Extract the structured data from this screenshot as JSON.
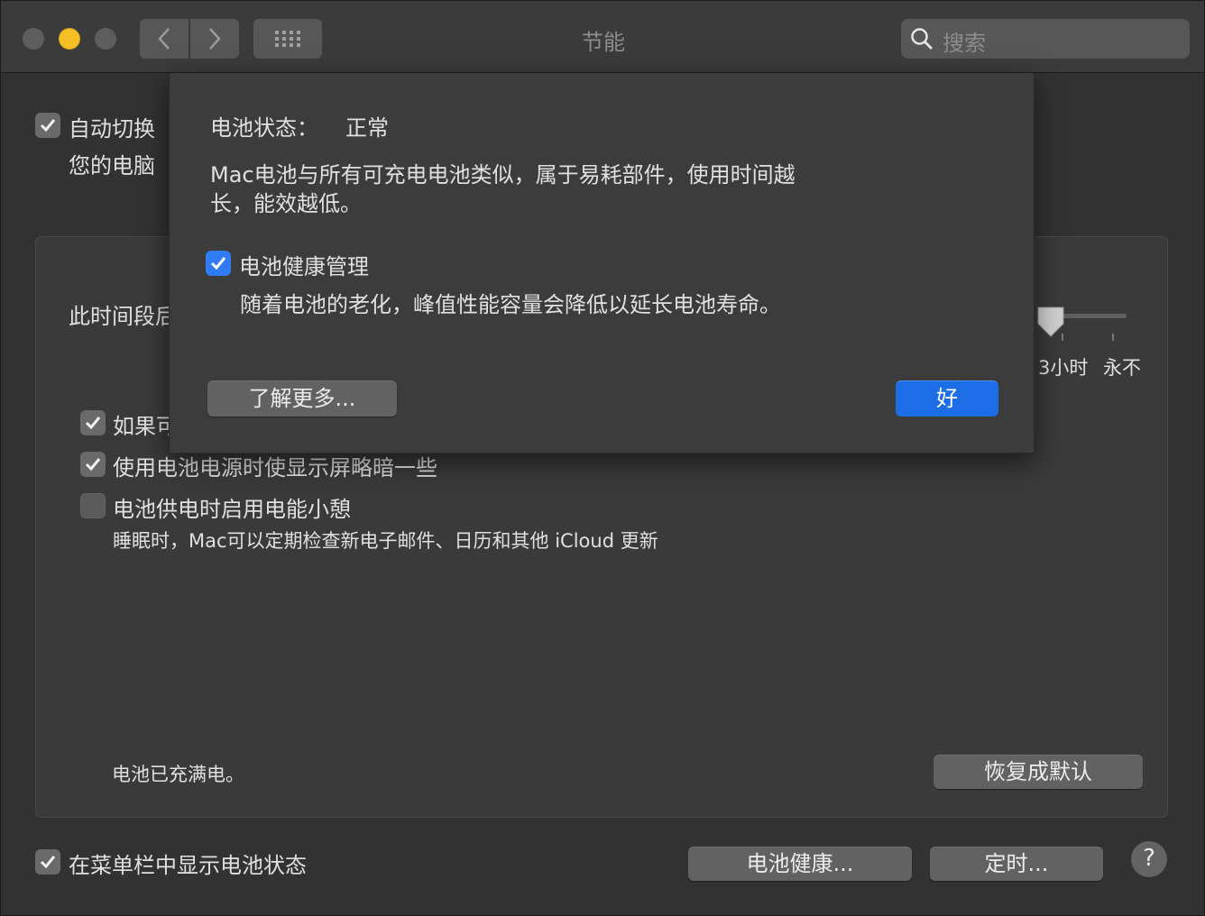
{
  "window": {
    "title": "节能",
    "search_placeholder": "搜索"
  },
  "top": {
    "auto_switch_label": "自动切换",
    "auto_switch_sub": "您的电脑"
  },
  "panel": {
    "turn_off_label": "此时间段后",
    "slider_labels": [
      "3小时",
      "永不"
    ],
    "options": [
      {
        "label": "如果可",
        "checked": true
      },
      {
        "label": "使用电池电源时使显示屏略暗一些",
        "checked": true
      },
      {
        "label": "电池供电时启用电能小憩",
        "checked": false,
        "description": "睡眠时，Mac可以定期检查新电子邮件、日历和其他 iCloud 更新"
      }
    ],
    "battery_status_text": "电池已充满电。",
    "restore_defaults_label": "恢复成默认"
  },
  "footer": {
    "show_in_menubar_label": "在菜单栏中显示电池状态",
    "show_in_menubar_checked": true,
    "battery_health_button": "电池健康...",
    "schedule_button": "定时...",
    "help_label": "?"
  },
  "sheet": {
    "status_label": "电池状态：",
    "status_value": "正常",
    "description_line1": "Mac电池与所有可充电电池类似，属于易耗部件，使用时间越",
    "description_line2": "长，能效越低。",
    "management_label": "电池健康管理",
    "management_checked": true,
    "management_description": "随着电池的老化，峰值性能容量会降低以延长电池寿命。",
    "learn_more_button": "了解更多...",
    "ok_button": "好"
  },
  "colors": {
    "accent": "#1b6ee6",
    "checkbox_blue": "#2f7cf6",
    "minimize_yellow": "#f4c025"
  }
}
